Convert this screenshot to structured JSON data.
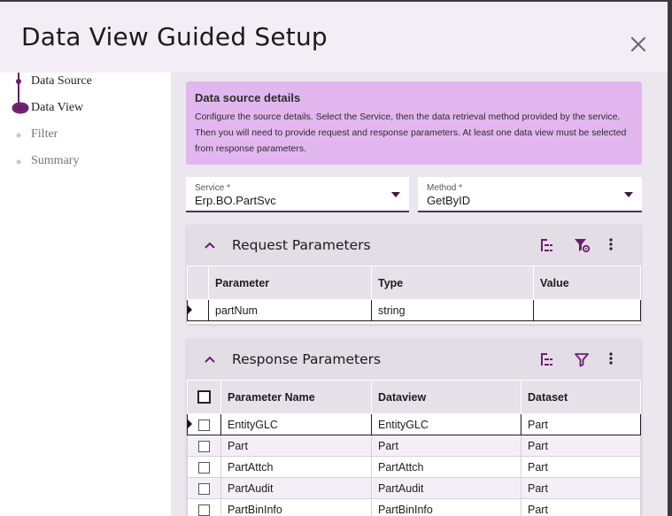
{
  "dialog": {
    "title": "Data View Guided Setup",
    "close_icon": "close-icon"
  },
  "steps": [
    {
      "label": "Data Source",
      "state": "done"
    },
    {
      "label": "Data View",
      "state": "active"
    },
    {
      "label": "Filter",
      "state": "todo"
    },
    {
      "label": "Summary",
      "state": "todo"
    }
  ],
  "info": {
    "title": "Data source details",
    "text": "Configure the source details. Select the Service, then the data retrieval method provided by the service. Then you will need to provide request and response parameters. At least one data view must be selected from response parameters."
  },
  "service": {
    "label": "Service *",
    "value": "Erp.BO.PartSvc"
  },
  "method": {
    "label": "Method *",
    "value": "GetByID"
  },
  "request": {
    "title": "Request Parameters",
    "columns": [
      "Parameter",
      "Type",
      "Value"
    ],
    "rows": [
      {
        "parameter": "partNum",
        "type": "string",
        "value": ""
      }
    ]
  },
  "response": {
    "title": "Response Parameters",
    "columns": [
      "Parameter Name",
      "Dataview",
      "Dataset"
    ],
    "rows": [
      {
        "name": "EntityGLC",
        "dataview": "EntityGLC",
        "dataset": "Part"
      },
      {
        "name": "Part",
        "dataview": "Part",
        "dataset": "Part"
      },
      {
        "name": "PartAttch",
        "dataview": "PartAttch",
        "dataset": "Part"
      },
      {
        "name": "PartAudit",
        "dataview": "PartAudit",
        "dataset": "Part"
      },
      {
        "name": "PartBinInfo",
        "dataview": "PartBinInfo",
        "dataset": "Part"
      }
    ]
  },
  "colors": {
    "accent": "#6a1e6e",
    "info_bg": "#e2b7f0",
    "dialog_bg": "#f3eef6",
    "content_bg": "#ece7ef"
  }
}
